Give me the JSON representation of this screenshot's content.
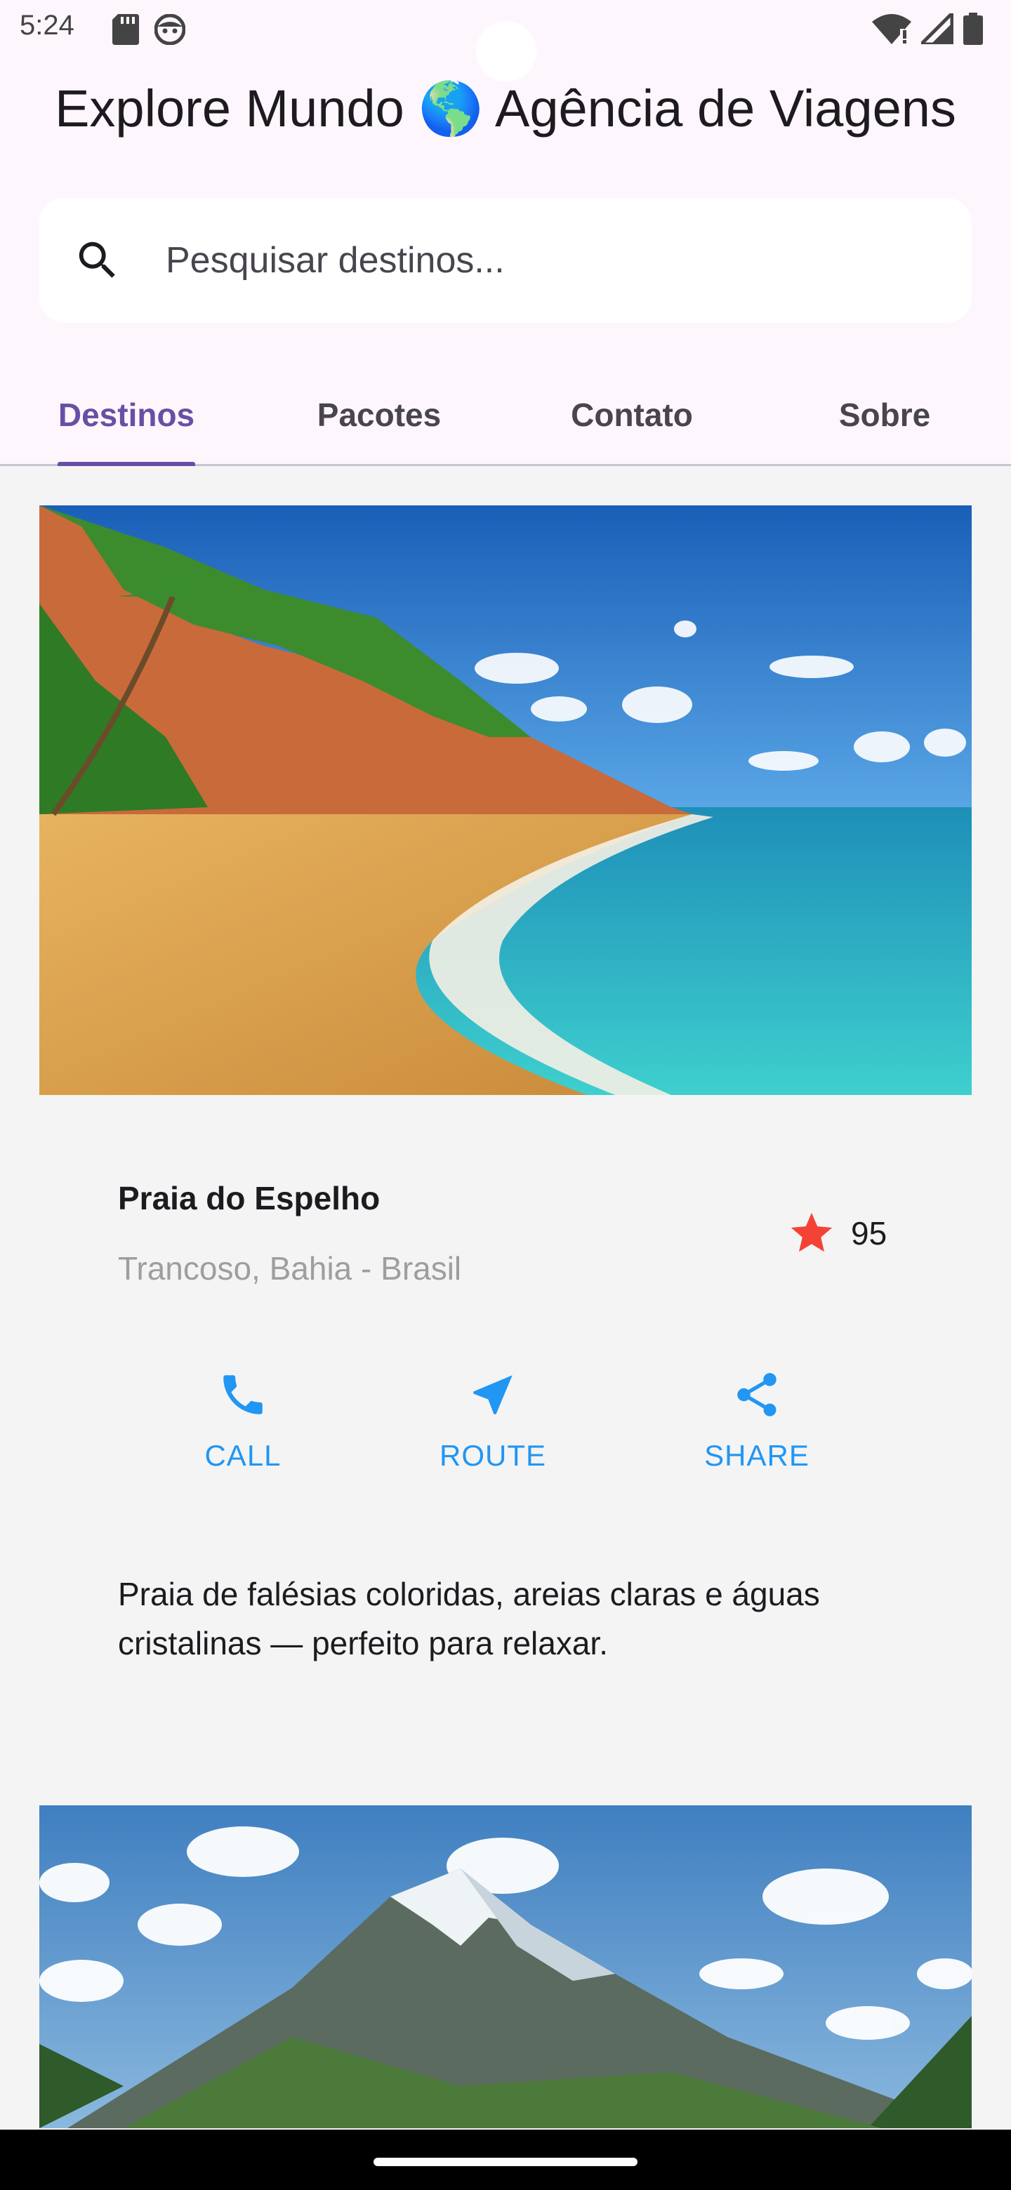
{
  "status_bar": {
    "time": "5:24",
    "icons": [
      "sd-card-icon",
      "face-icon",
      "wifi-icon",
      "signal-icon",
      "battery-icon"
    ]
  },
  "header": {
    "title": "Explore Mundo 🌎 Agência de Viagens"
  },
  "search": {
    "placeholder": "Pesquisar destinos...",
    "value": ""
  },
  "tabs": [
    {
      "label": "Destinos",
      "active": true
    },
    {
      "label": "Pacotes",
      "active": false
    },
    {
      "label": "Contato",
      "active": false
    },
    {
      "label": "Sobre",
      "active": false
    }
  ],
  "destination": {
    "name": "Praia do Espelho",
    "location": "Trancoso, Bahia - Brasil",
    "rating": "95",
    "actions": {
      "call": "CALL",
      "route": "ROUTE",
      "share": "SHARE"
    },
    "description": "Praia de falésias coloridas, areias claras e águas cristalinas — perfeito para relaxar."
  },
  "colors": {
    "accent": "#6750a4",
    "action_blue": "#2196f3",
    "star_red": "#f44336"
  }
}
